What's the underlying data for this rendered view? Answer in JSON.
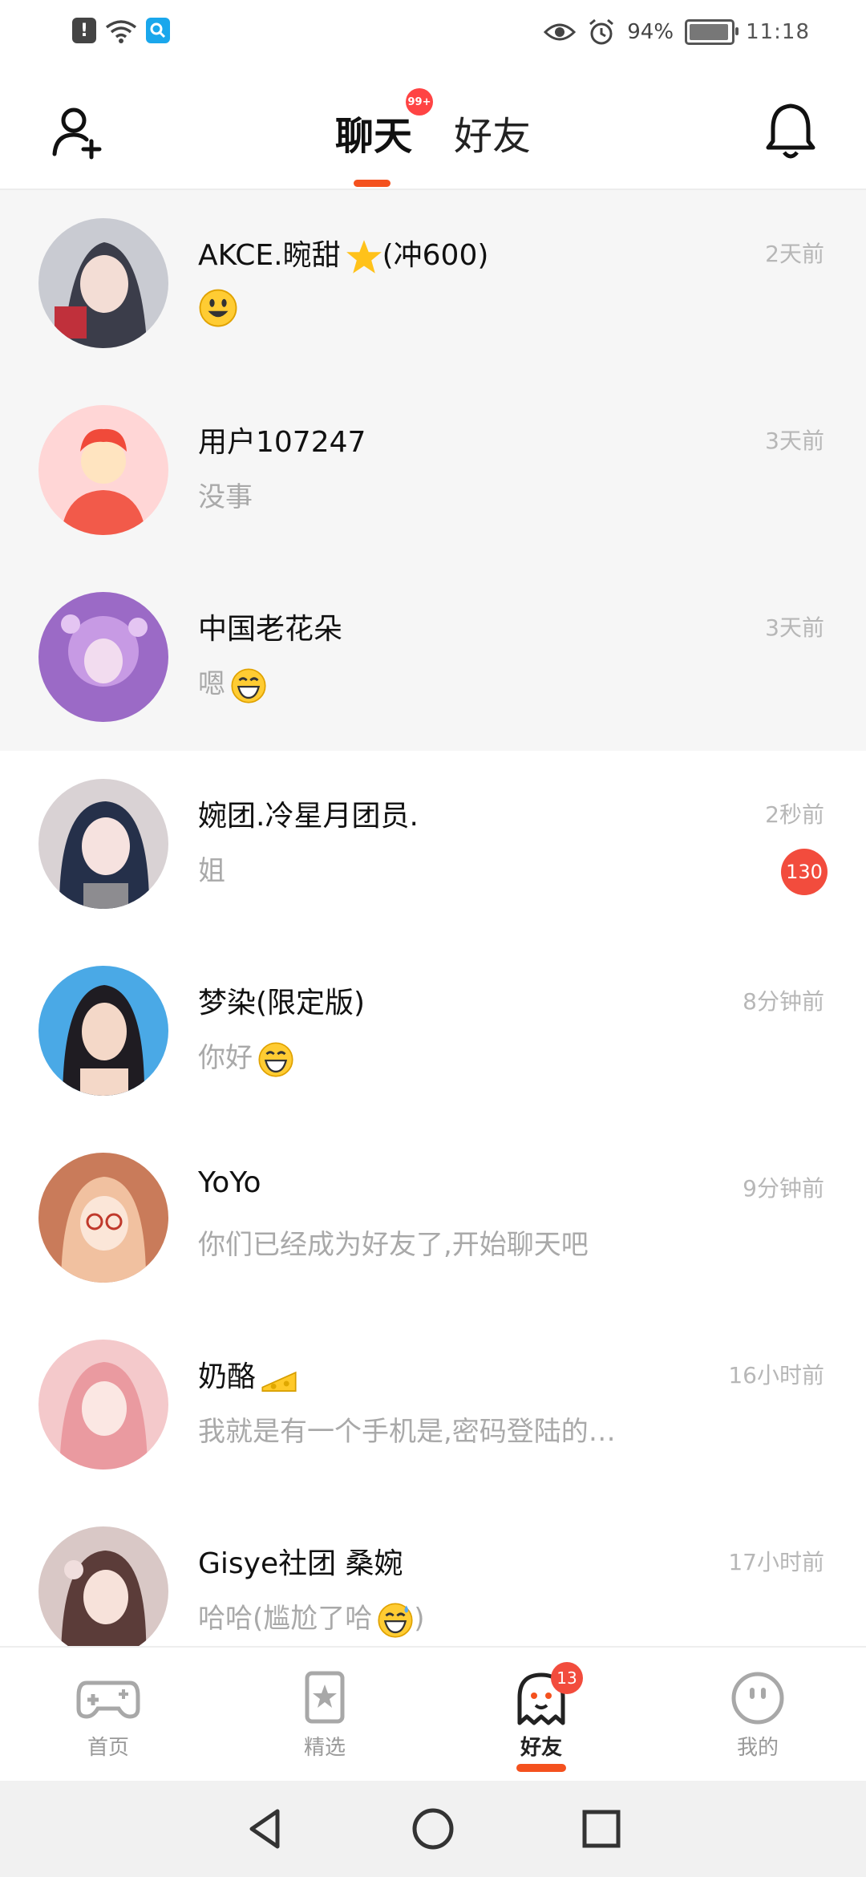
{
  "status_bar": {
    "battery": "94%",
    "time": "11:18"
  },
  "header": {
    "tabs": [
      {
        "label": "聊天",
        "badge": "99+"
      },
      {
        "label": "好友"
      }
    ]
  },
  "chats": [
    {
      "name": "AKCE.晼甜",
      "name_suffix": "(冲600)",
      "preview": "",
      "time": "2天前"
    },
    {
      "name": "用户107247",
      "preview": "没事",
      "time": "3天前"
    },
    {
      "name": "中国老花朵",
      "preview": "嗯",
      "time": "3天前"
    },
    {
      "name": "婉团.冷星月团员.",
      "preview": "姐",
      "time": "2秒前",
      "unread": "130"
    },
    {
      "name": "梦染(限定版)",
      "preview": "你好",
      "time": "8分钟前"
    },
    {
      "name": "YoYo",
      "preview": "你们已经成为好友了,开始聊天吧",
      "time": "9分钟前"
    },
    {
      "name": "奶酪",
      "preview": "我就是有一个手机是,密码登陆的…",
      "time": "16小时前"
    },
    {
      "name": "Gisye社团 桑婉",
      "preview": "哈哈(尴尬了哈",
      "preview_suffix": ")",
      "time": "17小时前"
    }
  ],
  "bottom_nav": [
    {
      "label": "首页"
    },
    {
      "label": "精选"
    },
    {
      "label": "好友",
      "badge": "13"
    },
    {
      "label": "我的"
    }
  ],
  "colors": {
    "accent": "#f4511e",
    "badge": "#f24c3d"
  }
}
